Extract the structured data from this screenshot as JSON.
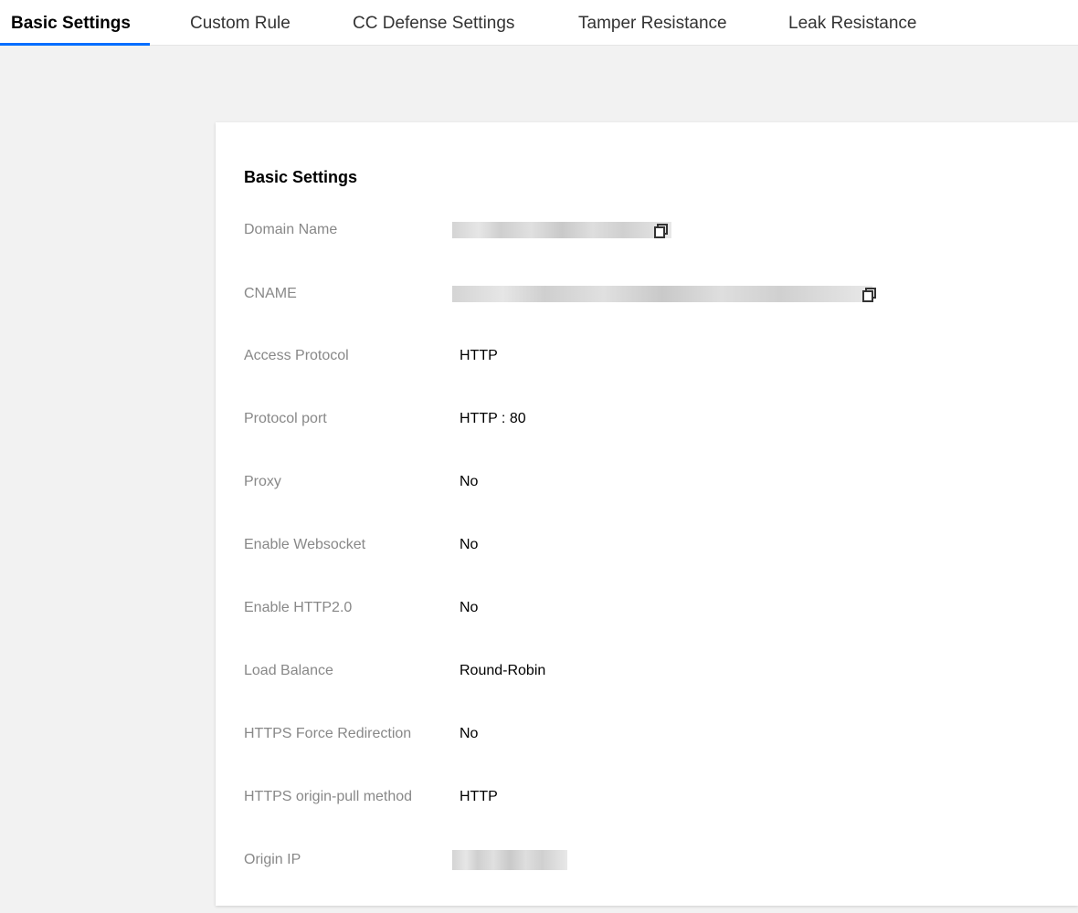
{
  "tabs": [
    {
      "label": "Basic Settings",
      "active": true
    },
    {
      "label": "Custom Rule",
      "active": false
    },
    {
      "label": "CC Defense Settings",
      "active": false
    },
    {
      "label": "Tamper Resistance",
      "active": false
    },
    {
      "label": "Leak Resistance",
      "active": false
    }
  ],
  "accent_color": "#006eff",
  "section": {
    "title": "Basic Settings",
    "fields": [
      {
        "label": "Domain Name",
        "value": "",
        "redacted": true,
        "copy_icon": "copy-icon"
      },
      {
        "label": "CNAME",
        "value": "",
        "redacted": true,
        "copy_icon": "copy-icon"
      },
      {
        "label": "Access Protocol",
        "value": "HTTP"
      },
      {
        "label": "Protocol port",
        "value": "HTTP : 80"
      },
      {
        "label": "Proxy",
        "value": "No"
      },
      {
        "label": "Enable Websocket",
        "value": "No"
      },
      {
        "label": "Enable HTTP2.0",
        "value": "No"
      },
      {
        "label": "Load Balance",
        "value": "Round-Robin"
      },
      {
        "label": "HTTPS Force Redirection",
        "value": "No"
      },
      {
        "label": "HTTPS origin-pull method",
        "value": "HTTP"
      },
      {
        "label": "Origin IP",
        "value": "",
        "redacted": true
      }
    ]
  }
}
